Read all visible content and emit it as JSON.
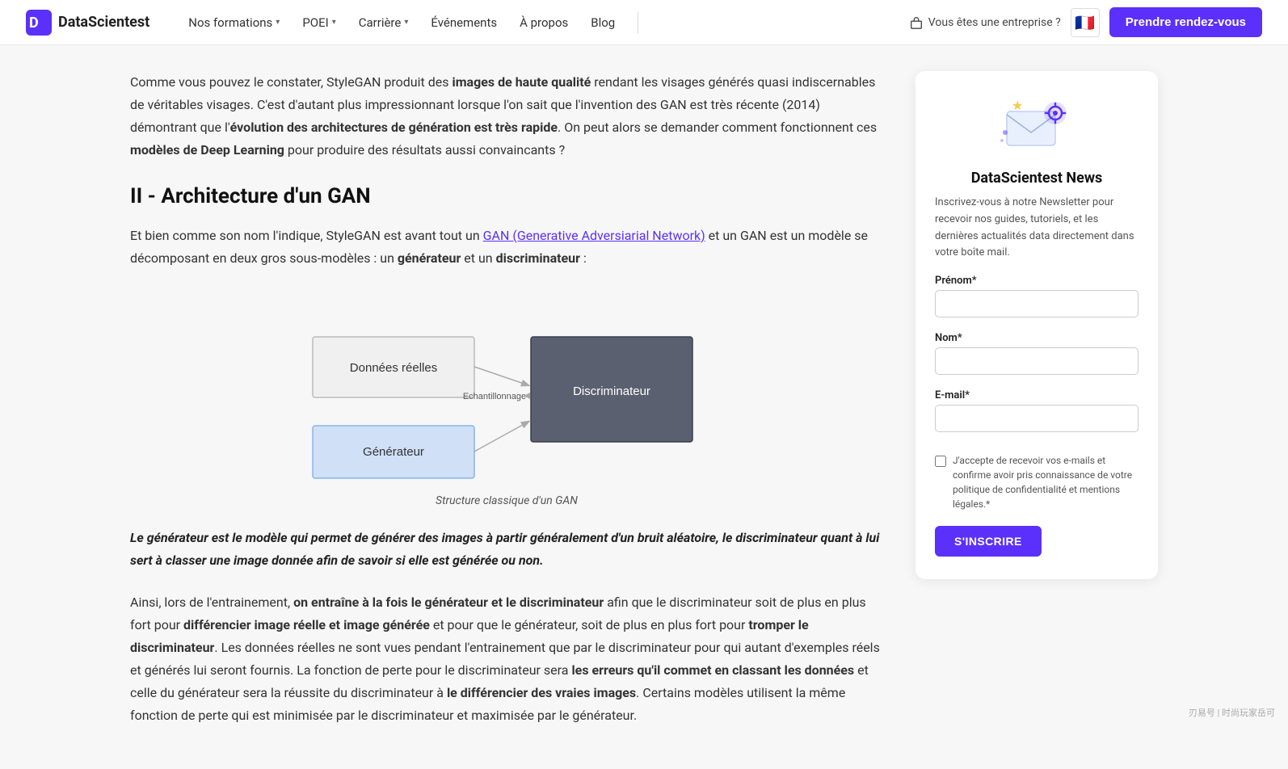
{
  "nav": {
    "logo_text": "DataScientest",
    "links": [
      {
        "label": "Nos formations",
        "has_dropdown": true
      },
      {
        "label": "POEI",
        "has_dropdown": true
      },
      {
        "label": "Carrière",
        "has_dropdown": true
      },
      {
        "label": "Événements",
        "has_dropdown": false
      },
      {
        "label": "À propos",
        "has_dropdown": false
      },
      {
        "label": "Blog",
        "has_dropdown": false
      }
    ],
    "enterprise_label": "Vous êtes une entreprise ?",
    "flag_emoji": "🇫🇷",
    "cta_label": "Prendre rendez-vous"
  },
  "article": {
    "intro_text_1": "Comme vous pouvez le constater, StyleGAN produit des ",
    "intro_bold_1": "images de haute qualité",
    "intro_text_2": " rendant les visages générés quasi indiscernables de véritables visages. C'est d'autant plus impressionnant lorsque l'on sait que l'invention des GAN est très récente (2014) démontrant que l'",
    "intro_bold_2": "évolution des architectures de génération est très rapide",
    "intro_text_3": ". On peut alors se demander comment fonctionnent ces ",
    "intro_bold_3": "modèles de Deep Learning",
    "intro_text_4": " pour produire des résultats aussi convaincants ?",
    "section_heading": "II - Architecture d'un GAN",
    "para1_text_1": "Et bien comme son nom l'indique, StyleGAN est avant tout un ",
    "para1_link_text": "GAN (Generative Adversiarial Network)",
    "para1_link_href": "#",
    "para1_text_2": " et un GAN est un modèle se décomposant en deux gros sous-modèles : un ",
    "para1_bold_1": "générateur",
    "para1_text_3": " et un ",
    "para1_bold_2": "discriminateur",
    "para1_text_4": " :",
    "diagram": {
      "box1_label": "Données réelles",
      "box2_label": "Discriminateur",
      "box3_label": "Générateur",
      "arrow_label": "Echantillonnage",
      "caption": "Structure classique d'un GAN"
    },
    "blockquote": "Le générateur est le modèle qui permet de générer des images à partir généralement d'un bruit aléatoire, le discriminateur quant à lui sert à classer une image donnée afin de savoir si elle est générée ou non.",
    "para2_text_1": "Ainsi, lors de l'entrainement, ",
    "para2_bold_1": "on entraîne à la fois le générateur et le discriminateur",
    "para2_text_2": " afin que le discriminateur soit de plus en plus fort pour ",
    "para2_bold_2": "différencier image réelle et image générée",
    "para2_text_3": " et pour que le générateur, soit de plus en plus fort pour ",
    "para2_bold_3": "tromper le discriminateur",
    "para2_text_4": ". Les données réelles ne sont vues pendant l'entrainement que par le discriminateur pour qui autant d'exemples réels et générés lui seront fournis. La fonction de perte pour le discriminateur sera ",
    "para2_bold_4": "les erreurs qu'il commet en classant les données",
    "para2_text_5": " et celle du générateur sera la réussite du discriminateur à ",
    "para2_bold_5": "le différencier des vraies images",
    "para2_text_6": ". Certains modèles utilisent la même fonction de perte qui est minimisée par le discriminateur et maximisée par le générateur."
  },
  "sidebar": {
    "newsletter_title": "DataScientest News",
    "newsletter_desc": "Inscrivez-vous à notre Newsletter pour recevoir nos guides, tutoriels, et les dernières actualités data directement dans votre boîte mail.",
    "prenom_label": "Prénom*",
    "prenom_placeholder": "",
    "nom_label": "Nom*",
    "nom_placeholder": "",
    "email_label": "E-mail*",
    "email_placeholder": "",
    "checkbox_label": "J'accepte de recevoir vos e-mails et confirme avoir pris connaissance de votre politique de confidentialité et mentions légales.*",
    "subscribe_btn": "S'INSCRIRE"
  },
  "watermark": "刃易号 | 时尚玩家岳可"
}
